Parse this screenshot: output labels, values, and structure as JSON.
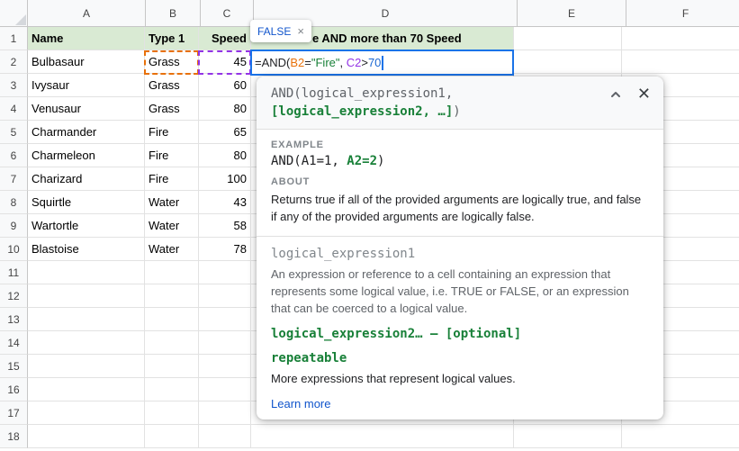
{
  "sheet": {
    "column_headers": [
      "A",
      "B",
      "C",
      "D",
      "E",
      "F"
    ],
    "row_numbers": [
      "1",
      "2",
      "3",
      "4",
      "5",
      "6",
      "7",
      "8",
      "9",
      "10",
      "11",
      "12",
      "13",
      "14",
      "15",
      "16",
      "17",
      "18"
    ],
    "header_row": {
      "name": "Name",
      "type": "Type 1",
      "speed": "Speed",
      "d1_visible": "e AND more than 70 Speed"
    },
    "rows": [
      {
        "name": "Bulbasaur",
        "type": "Grass",
        "speed": "45"
      },
      {
        "name": "Ivysaur",
        "type": "Grass",
        "speed": "60"
      },
      {
        "name": "Venusaur",
        "type": "Grass",
        "speed": "80"
      },
      {
        "name": "Charmander",
        "type": "Fire",
        "speed": "65"
      },
      {
        "name": "Charmeleon",
        "type": "Fire",
        "speed": "80"
      },
      {
        "name": "Charizard",
        "type": "Fire",
        "speed": "100"
      },
      {
        "name": "Squirtle",
        "type": "Water",
        "speed": "43"
      },
      {
        "name": "Wartortle",
        "type": "Water",
        "speed": "58"
      },
      {
        "name": "Blastoise",
        "type": "Water",
        "speed": "78"
      }
    ]
  },
  "formula_editor": {
    "result_chip": {
      "value": "FALSE",
      "close_glyph": "×"
    },
    "tokens": [
      {
        "text": "=AND(",
        "color": "#202124"
      },
      {
        "text": "B2",
        "color": "#e8710a"
      },
      {
        "text": "=",
        "color": "#202124"
      },
      {
        "text": "\"Fire\"",
        "color": "#188038"
      },
      {
        "text": ", ",
        "color": "#202124"
      },
      {
        "text": "C2",
        "color": "#9334e6"
      },
      {
        "text": ">",
        "color": "#202124"
      },
      {
        "text": "70",
        "color": "#1967d2"
      }
    ]
  },
  "help_panel": {
    "signature": {
      "line1": "AND(logical_expression1,",
      "line2_active": "[logical_expression2, …]",
      "line2_close": ")"
    },
    "close_glyph": "✕",
    "example": {
      "label": "EXAMPLE",
      "code_pre": "AND(A1=1, ",
      "code_highlight": "A2=2",
      "code_post": ")"
    },
    "about": {
      "label": "ABOUT",
      "text": "Returns true if all of the provided arguments are logically true, and false if any of the provided arguments are logically false."
    },
    "parameters": [
      {
        "name": "logical_expression1",
        "description": "An expression or reference to a cell containing an expression that represents some logical value, i.e. TRUE or FALSE, or an expression that can be coerced to a logical value."
      },
      {
        "name": "logical_expression2… – [optional]",
        "tag": "repeatable",
        "description": "More expressions that represent logical values."
      }
    ],
    "learn_more": "Learn more"
  },
  "colors": {
    "active_cell_border": "#1a73e8",
    "reference1": "#e8710a",
    "reference2": "#9334e6",
    "function_green": "#188038",
    "link_blue": "#1155cc",
    "chip_value_blue": "#1155cc",
    "header_row_green": "#d9ead3"
  }
}
